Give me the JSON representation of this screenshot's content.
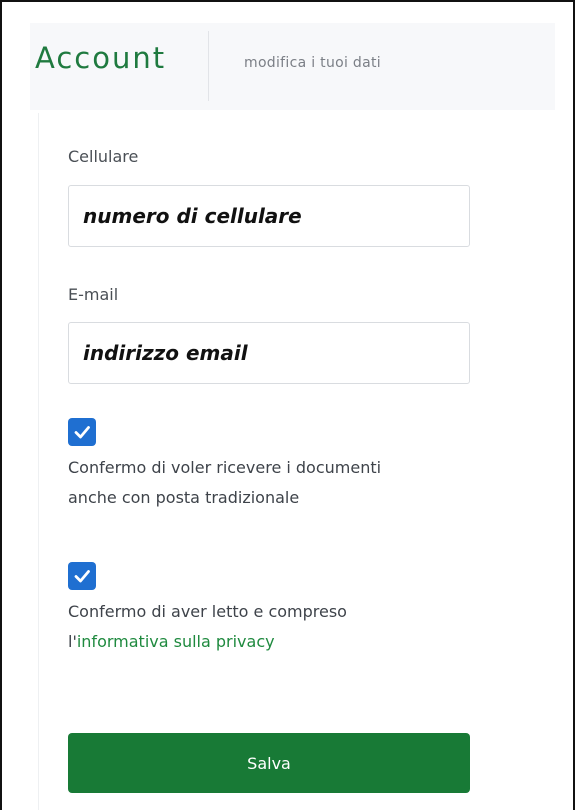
{
  "header": {
    "title": "Account",
    "subtitle": "modifica i tuoi dati"
  },
  "form": {
    "mobile": {
      "label": "Cellulare",
      "value": "numero di cellulare"
    },
    "email": {
      "label": "E-mail",
      "value": "indirizzo email"
    },
    "paper_mail_consent": {
      "checked": true,
      "line1": "Confermo di voler ricevere i documenti",
      "line2": "anche con posta tradizionale"
    },
    "privacy_consent": {
      "checked": true,
      "line1": "Confermo di aver letto e compreso",
      "prefix": "l'",
      "link_text": "informativa sulla privacy"
    },
    "save_label": "Salva"
  },
  "colors": {
    "accent_green": "#1f7a3f",
    "button_green": "#187a36",
    "checkbox_blue": "#1f6fd1"
  }
}
